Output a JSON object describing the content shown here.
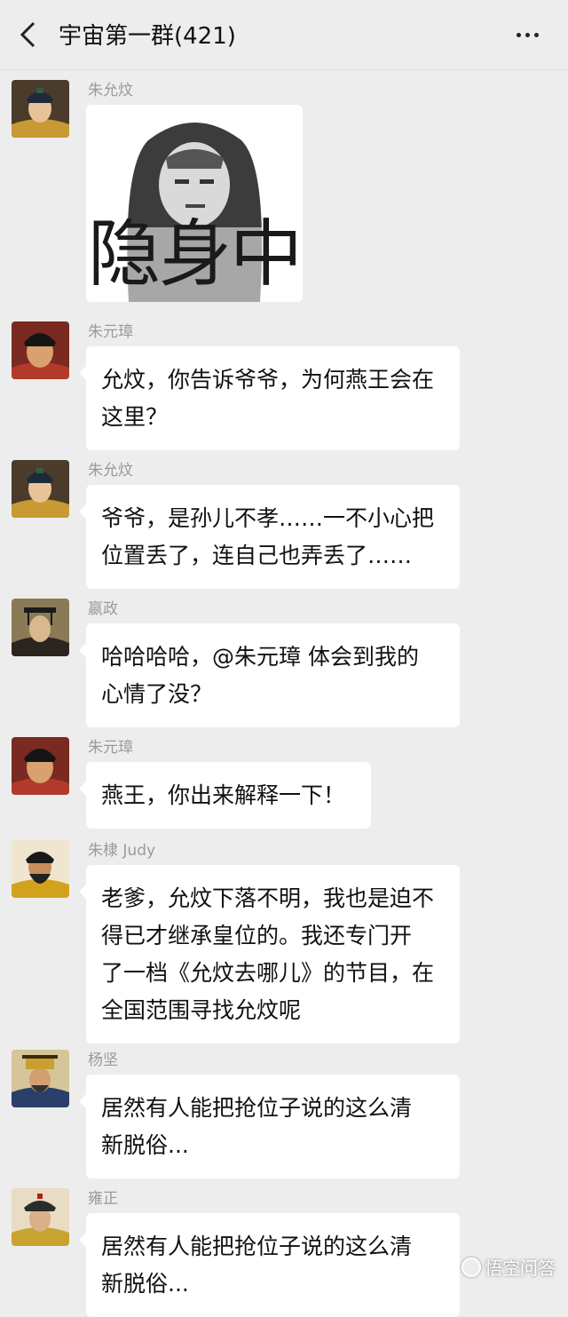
{
  "header": {
    "title": "宇宙第一群(421)"
  },
  "icons": {
    "back": "chevron-left-icon",
    "more": "more-dots-icon"
  },
  "messages": [
    {
      "sender": "朱允炆",
      "type": "sticker",
      "sticker_text": "隐身中"
    },
    {
      "sender": "朱元璋",
      "lines": [
        "允炆，你告诉爷爷，为何燕王会在",
        "这里？"
      ]
    },
    {
      "sender": "朱允炆",
      "lines": [
        "爷爷，是孙儿不孝……一不小心把",
        "位置丢了，连自己也弄丢了……"
      ]
    },
    {
      "sender": "嬴政",
      "lines": [
        "哈哈哈哈，@朱元璋 体会到我的",
        "心情了没？"
      ]
    },
    {
      "sender": "朱元璋",
      "lines": [
        "燕王，你出来解释一下！"
      ]
    },
    {
      "sender": "朱棣 Judy",
      "lines": [
        "老爹，允炆下落不明，我也是迫不",
        "得已才继承皇位的。我还专门开",
        "了一档《允炆去哪儿》的节目，在",
        "全国范围寻找允炆呢"
      ]
    },
    {
      "sender": "杨坚",
      "lines": [
        "居然有人能把抢位子说的这么清",
        "新脱俗..."
      ]
    },
    {
      "sender": "雍正",
      "lines": [
        "居然有人能把抢位子说的这么清",
        "新脱俗..."
      ]
    }
  ],
  "watermark": {
    "text": "悟空问答"
  },
  "colors": {
    "background": "#ededed",
    "bubble": "#ffffff",
    "sender_name": "#9a9a9a"
  }
}
